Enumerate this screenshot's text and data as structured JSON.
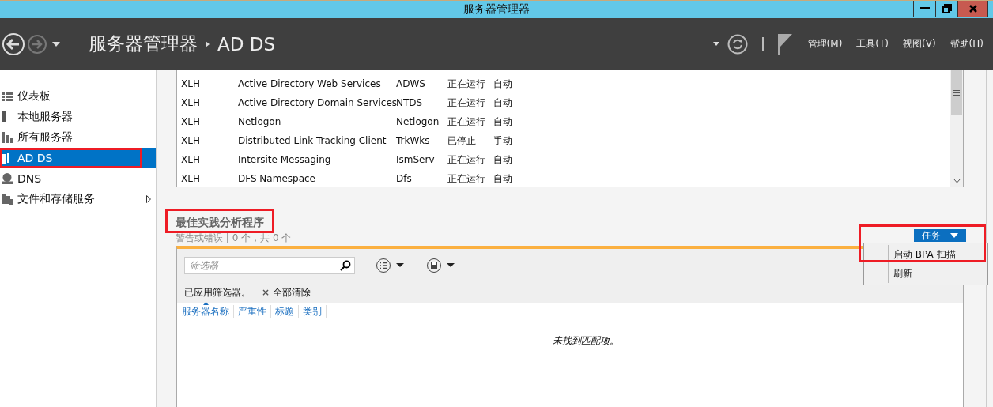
{
  "window": {
    "title": "服务器管理器"
  },
  "header": {
    "breadcrumb_root": "服务器管理器",
    "breadcrumb_current": "AD DS",
    "menus": [
      "管理(M)",
      "工具(T)",
      "视图(V)",
      "帮助(H)"
    ]
  },
  "sidebar": {
    "items": [
      {
        "label": "仪表板",
        "kind": "dashboard",
        "selected": false,
        "highlighted": false,
        "submenu": false
      },
      {
        "label": "本地服务器",
        "kind": "server",
        "selected": false,
        "highlighted": false,
        "submenu": false
      },
      {
        "label": "所有服务器",
        "kind": "servers",
        "selected": false,
        "highlighted": false,
        "submenu": false
      },
      {
        "label": "AD DS",
        "kind": "adds",
        "selected": true,
        "highlighted": true,
        "submenu": false
      },
      {
        "label": "DNS",
        "kind": "dns",
        "selected": false,
        "highlighted": false,
        "submenu": false
      },
      {
        "label": "文件和存储服务",
        "kind": "folder",
        "selected": false,
        "highlighted": false,
        "submenu": true
      }
    ]
  },
  "services": {
    "rows": [
      [
        "XLH",
        "Active Directory Web Services",
        "ADWS",
        "正在运行",
        "自动"
      ],
      [
        "XLH",
        "Active Directory Domain Services",
        "NTDS",
        "正在运行",
        "自动"
      ],
      [
        "XLH",
        "Netlogon",
        "Netlogon",
        "正在运行",
        "自动"
      ],
      [
        "XLH",
        "Distributed Link Tracking Client",
        "TrkWks",
        "已停止",
        "手动"
      ],
      [
        "XLH",
        "Intersite Messaging",
        "IsmServ",
        "正在运行",
        "自动"
      ],
      [
        "XLH",
        "DFS Namespace",
        "Dfs",
        "正在运行",
        "自动"
      ]
    ]
  },
  "bpa": {
    "title": "最佳实践分析程序",
    "title_highlighted": true,
    "subtitle": "警告或错误 | 0 个，共 0 个",
    "tasks_button": "任务",
    "tasks_highlighted": true,
    "task_menu": [
      "启动 BPA 扫描",
      "刷新"
    ],
    "filter": {
      "placeholder": "筛选器"
    },
    "filter_status": "已应用筛选器。",
    "clear_icon": "×",
    "clear_all": "全部清除",
    "columns": [
      {
        "label": "服务器名称",
        "sorted": true
      },
      {
        "label": "严重性",
        "sorted": false
      },
      {
        "label": "标题",
        "sorted": false
      },
      {
        "label": "类别",
        "sorted": false
      }
    ],
    "empty_message": "未找到匹配项。"
  }
}
